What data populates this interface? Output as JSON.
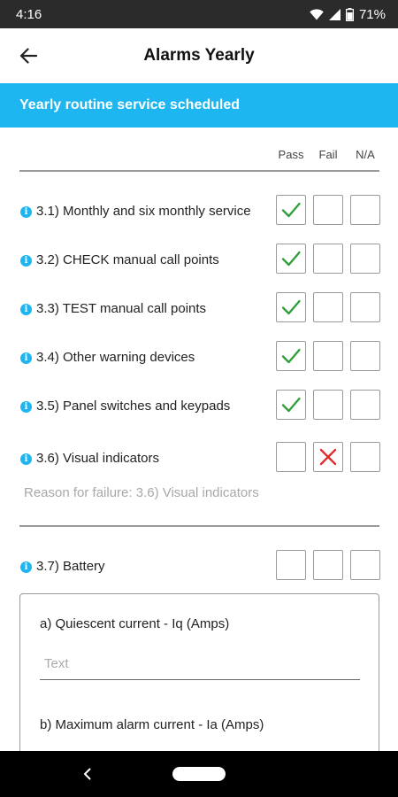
{
  "status_bar": {
    "time": "4:16",
    "battery": "71%",
    "icons": [
      "wifi-icon",
      "signal-icon",
      "battery-icon"
    ]
  },
  "app_bar": {
    "title": "Alarms Yearly",
    "back_icon": "arrow-left-icon"
  },
  "banner": {
    "text": "Yearly routine service scheduled",
    "color": "#1eb6f0"
  },
  "columns": {
    "pass": "Pass",
    "fail": "Fail",
    "na": "N/A"
  },
  "rows": [
    {
      "label": "3.1)  Monthly and six monthly service",
      "state": "pass"
    },
    {
      "label": "3.2)  CHECK manual call points",
      "state": "pass"
    },
    {
      "label": "3.3)  TEST manual call points",
      "state": "pass"
    },
    {
      "label": "3.4)  Other warning devices",
      "state": "pass"
    },
    {
      "label": "3.5)  Panel switches and keypads",
      "state": "pass"
    },
    {
      "label": "3.6)  Visual indicators",
      "state": "fail"
    },
    {
      "label": "3.7)  Battery",
      "state": "none"
    }
  ],
  "reason": {
    "placeholder": "Reason for failure: 3.6)  Visual indicators"
  },
  "battery_card": {
    "field_a": {
      "label": "a) Quiescent current - Iq (Amps)",
      "placeholder": "Text",
      "value": ""
    },
    "field_b": {
      "label": "b) Maximum alarm current - Ia (Amps)"
    }
  },
  "colors": {
    "pass_check": "#2e9e3a",
    "fail_cross": "#e02b2b",
    "info_icon": "#1eb6f0"
  }
}
